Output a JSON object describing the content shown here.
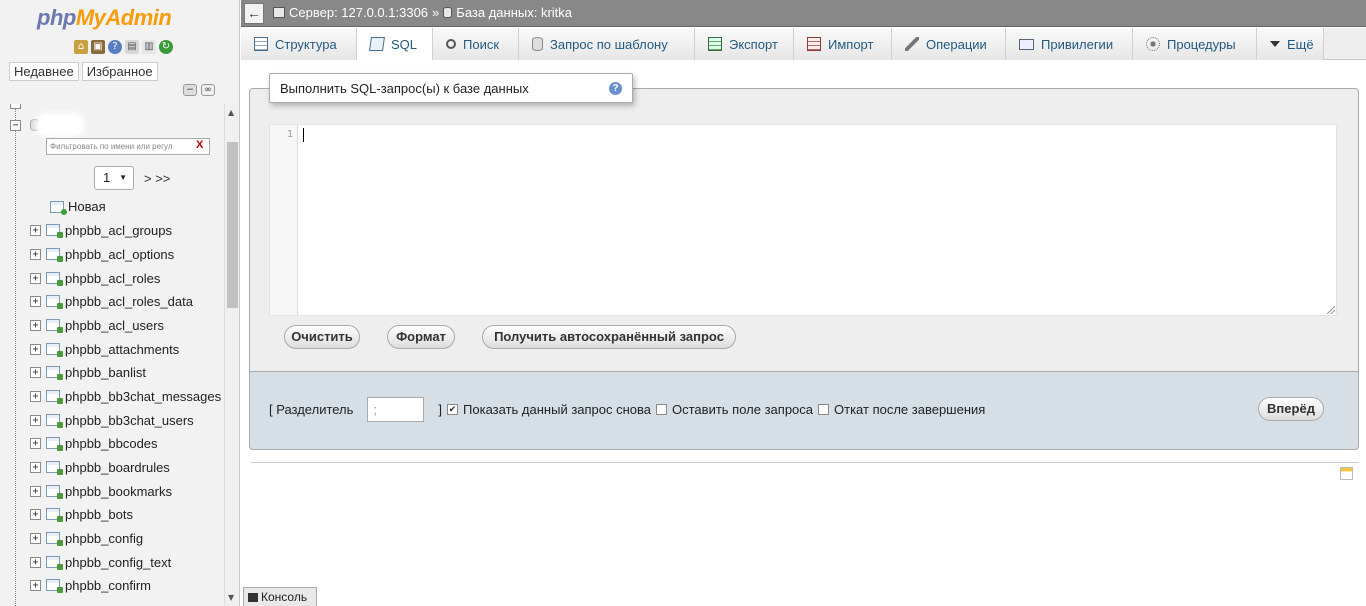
{
  "app": {
    "logo_part1": "php",
    "logo_part2": "MyAdmin"
  },
  "nav": {
    "tabs": [
      "Недавнее",
      "Избранное"
    ],
    "filter_placeholder": "Фильтровать по имени или регул",
    "filter_clear": "X",
    "page_selected": "1",
    "page_next": "> >>",
    "new_label": "Новая",
    "tables": [
      "phpbb_acl_groups",
      "phpbb_acl_options",
      "phpbb_acl_roles",
      "phpbb_acl_roles_data",
      "phpbb_acl_users",
      "phpbb_attachments",
      "phpbb_banlist",
      "phpbb_bb3chat_messages",
      "phpbb_bb3chat_users",
      "phpbb_bbcodes",
      "phpbb_boardrules",
      "phpbb_bookmarks",
      "phpbb_bots",
      "phpbb_config",
      "phpbb_config_text",
      "phpbb_confirm"
    ]
  },
  "breadcrumb": {
    "server": "Сервер: 127.0.0.1:3306",
    "separator": "»",
    "database": "База данных: kritka"
  },
  "tabs": [
    {
      "label": "Структура",
      "icon": "structure-icon"
    },
    {
      "label": "SQL",
      "icon": "sql-icon"
    },
    {
      "label": "Поиск",
      "icon": "search-icon"
    },
    {
      "label": "Запрос по шаблону",
      "icon": "query-icon"
    },
    {
      "label": "Экспорт",
      "icon": "export-icon"
    },
    {
      "label": "Импорт",
      "icon": "import-icon"
    },
    {
      "label": "Операции",
      "icon": "wrench-icon"
    },
    {
      "label": "Привилегии",
      "icon": "privileges-icon"
    },
    {
      "label": "Процедуры",
      "icon": "procedures-icon"
    },
    {
      "label": "Ещё",
      "icon": "chevron-down-icon"
    }
  ],
  "sql_panel": {
    "legend": "Выполнить SQL-запрос(ы) к базе данных",
    "line_number": "1",
    "buttons": {
      "clear": "Очистить",
      "format": "Формат",
      "autosave": "Получить автосохранённый запрос"
    }
  },
  "options": {
    "delimiter_label_open": "[ Разделитель",
    "delimiter_value": ";",
    "delimiter_label_close": "]",
    "show_query_again": "Показать данный запрос снова",
    "show_query_again_checked": true,
    "retain_query_box": "Оставить поле запроса",
    "rollback_when_finished": "Откат после завершения",
    "go_button": "Вперёд"
  },
  "console": {
    "label": "Консоль"
  }
}
